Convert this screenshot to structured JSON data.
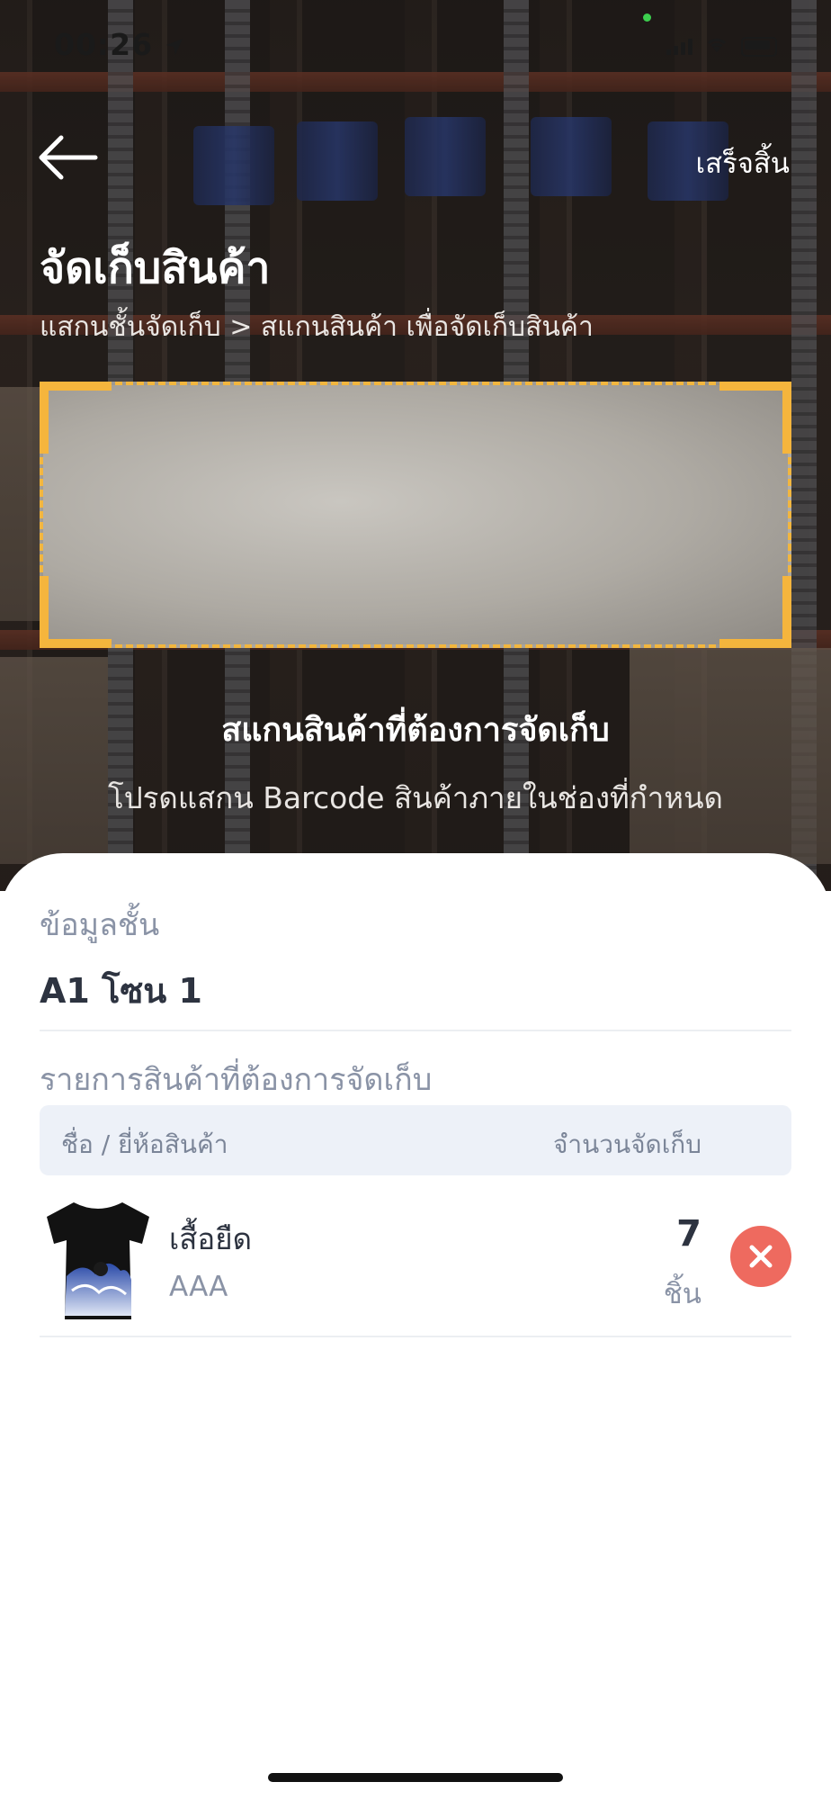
{
  "status_bar": {
    "time": "00:26",
    "icons": [
      "location-arrow-icon",
      "cellular-signal-icon",
      "wifi-icon",
      "battery-icon"
    ]
  },
  "header": {
    "back_icon": "arrow-left-icon",
    "done_label": "เสร็จสิ้น",
    "title": "จัดเก็บสินค้า",
    "breadcrumb": "แสกนชั้นจัดเก็บ > สแกนสินค้า เพื่อจัดเก็บสินค้า"
  },
  "scanner": {
    "title": "สแกนสินค้าที่ต้องการจัดเก็บ",
    "instruction": "โปรดแสกน Barcode สินค้าภายในช่องที่กำหนด",
    "frame_color": "#F5B53D"
  },
  "shelf_info": {
    "label": "ข้อมูลชั้น",
    "value": "A1 โซน 1"
  },
  "product_list": {
    "label": "รายการสินค้าที่ต้องการจัดเก็บ",
    "columns": {
      "name": "ชื่อ / ยี่ห้อสินค้า",
      "quantity": "จำนวนจัดเก็บ"
    },
    "items": [
      {
        "image_icon": "tshirt-wave-print-image",
        "name": "เสื้อยืด",
        "brand": "AAA",
        "quantity": "7",
        "unit": "ชิ้น",
        "remove_icon": "close-icon"
      }
    ]
  },
  "colors": {
    "accent": "#F5B53D",
    "remove": "#EE6A5F",
    "table_header_bg": "#EDF1F8",
    "muted_text": "#8A93A6",
    "primary_text": "#2D3340"
  }
}
